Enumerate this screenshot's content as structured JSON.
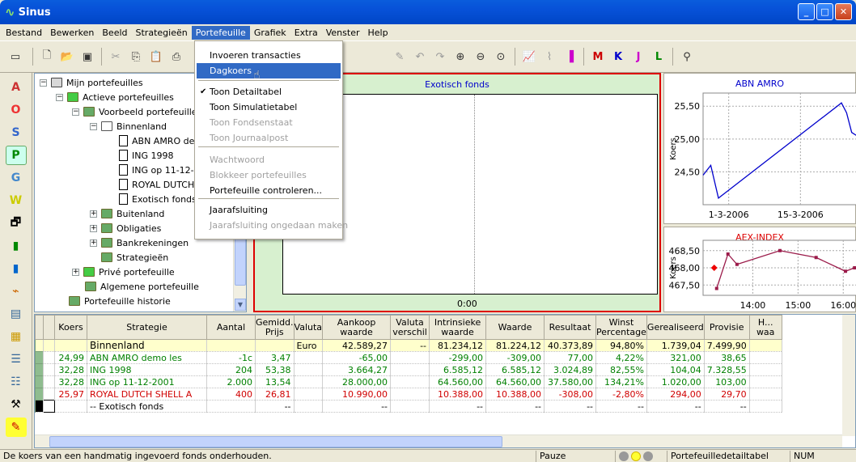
{
  "app": {
    "title": "Sinus"
  },
  "menubar": [
    "Bestand",
    "Bewerken",
    "Beeld",
    "Strategieën",
    "Portefeuille",
    "Grafiek",
    "Extra",
    "Venster",
    "Help"
  ],
  "menu": {
    "items": [
      {
        "label": "Invoeren transacties",
        "state": "normal"
      },
      {
        "label": "Dagkoers",
        "state": "selected"
      },
      {
        "label": "Toon Detailtabel",
        "state": "checked"
      },
      {
        "label": "Toon Simulatietabel",
        "state": "normal"
      },
      {
        "label": "Toon Fondsenstaat",
        "state": "disabled"
      },
      {
        "label": "Toon Journaalpost",
        "state": "disabled"
      },
      {
        "label": "Wachtwoord",
        "state": "disabled"
      },
      {
        "label": "Blokkeer portefeuilles",
        "state": "disabled"
      },
      {
        "label": "Portefeuille controleren...",
        "state": "normal"
      },
      {
        "label": "Jaarafsluiting",
        "state": "normal"
      },
      {
        "label": "Jaarafsluiting ongedaan maken",
        "state": "disabled"
      }
    ]
  },
  "tree": [
    {
      "label": "Mijn portefeuilles",
      "exp": "−"
    },
    {
      "label": "Actieve portefeuilles",
      "exp": "−"
    },
    {
      "label": "Voorbeeld portefeuille",
      "exp": "−"
    },
    {
      "label": "Binnenland",
      "exp": "−"
    },
    {
      "label": "ABN AMRO de",
      "exp": ""
    },
    {
      "label": "ING 1998",
      "exp": ""
    },
    {
      "label": "ING op 11-12-",
      "exp": ""
    },
    {
      "label": "ROYAL DUTCH",
      "exp": ""
    },
    {
      "label": "Exotisch fonds",
      "exp": ""
    },
    {
      "label": "Buitenland",
      "exp": "+"
    },
    {
      "label": "Obligaties",
      "exp": "+"
    },
    {
      "label": "Bankrekeningen",
      "exp": "+"
    },
    {
      "label": "Strategieën",
      "exp": ""
    },
    {
      "label": "Privé portefeuille",
      "exp": "+"
    },
    {
      "label": "Algemene portefeuille",
      "exp": ""
    },
    {
      "label": "Portefeuille historie",
      "exp": ""
    }
  ],
  "main_chart": {
    "title": "Exotisch fonds",
    "xlabel": "0:00"
  },
  "chart_data": [
    {
      "type": "line",
      "title": "ABN AMRO",
      "ylabel": "Koers",
      "yticks": [
        "25,50",
        "25,00",
        "24,50"
      ],
      "xticks": [
        "1-3-2006",
        "15-3-2006"
      ],
      "ylim": [
        24.0,
        25.7
      ],
      "xlim": [
        0,
        30
      ],
      "series": [
        {
          "x": [
            0,
            1.5,
            3,
            27,
            28,
            29,
            30
          ],
          "values": [
            24.45,
            24.6,
            24.1,
            25.55,
            25.4,
            25.1,
            25.05
          ]
        }
      ]
    },
    {
      "type": "line",
      "title": "AEX-INDEX",
      "ylabel": "Koers",
      "yticks": [
        "468,50",
        "468,00",
        "467,50"
      ],
      "xticks": [
        "14:00",
        "15:00",
        "16:00"
      ],
      "ylim": [
        467.2,
        468.8
      ],
      "xlim": [
        12.9,
        16.3
      ],
      "series": [
        {
          "x": [
            13.2,
            13.45,
            13.65,
            14.6,
            15.4,
            16.05,
            16.25
          ],
          "values": [
            467.4,
            468.4,
            468.1,
            468.5,
            468.3,
            467.9,
            468.0
          ]
        }
      ]
    }
  ],
  "table": {
    "headers": [
      "Koers",
      "Strategie",
      "Aantal",
      "Gemidd. Prijs",
      "Valuta",
      "Aankoop waarde",
      "Valuta verschil",
      "Intrinsieke waarde",
      "Waarde",
      "Resultaat",
      "Winst Percentage",
      "Gerealiseerd",
      "Provisie",
      "H... waa"
    ],
    "rows": [
      {
        "style": "bin",
        "cells": [
          "",
          "Binnenland",
          "",
          "",
          "Euro",
          "42.589,27",
          "--",
          "81.234,12",
          "81.224,12",
          "40.373,89",
          "94,80%",
          "1.739,04",
          "7.499,90",
          ""
        ]
      },
      {
        "style": "green",
        "cells": [
          "24,99",
          "ABN AMRO demo les",
          "-1c",
          "3,47",
          "",
          "-65,00",
          "",
          "-299,00",
          "-309,00",
          "77,00",
          "4,22%",
          "321,00",
          "38,65",
          ""
        ]
      },
      {
        "style": "green",
        "cells": [
          "32,28",
          "ING 1998",
          "204",
          "53,38",
          "",
          "3.664,27",
          "",
          "6.585,12",
          "6.585,12",
          "3.024,89",
          "82,55%",
          "104,04",
          "7.328,55",
          ""
        ]
      },
      {
        "style": "green",
        "cells": [
          "32,28",
          "ING op 11-12-2001",
          "2.000",
          "13,54",
          "",
          "28.000,00",
          "",
          "64.560,00",
          "64.560,00",
          "37.580,00",
          "134,21%",
          "1.020,00",
          "103,00",
          ""
        ]
      },
      {
        "style": "red",
        "cells": [
          "25,97",
          "ROYAL DUTCH SHELL A",
          "400",
          "26,81",
          "",
          "10.990,00",
          "",
          "10.388,00",
          "10.388,00",
          "-308,00",
          "-2,80%",
          "294,00",
          "29,70",
          ""
        ]
      },
      {
        "style": "b",
        "cells": [
          "",
          "-- Exotisch fonds",
          "",
          "--",
          "",
          "--",
          "",
          "--",
          "--",
          "--",
          "--",
          "--",
          "--",
          ""
        ]
      }
    ]
  },
  "status": {
    "message": "De koers van een handmatig ingevoerd fonds onderhouden.",
    "pauze": "Pauze",
    "table": "Portefeuilledetailtabel",
    "num": "NUM"
  }
}
